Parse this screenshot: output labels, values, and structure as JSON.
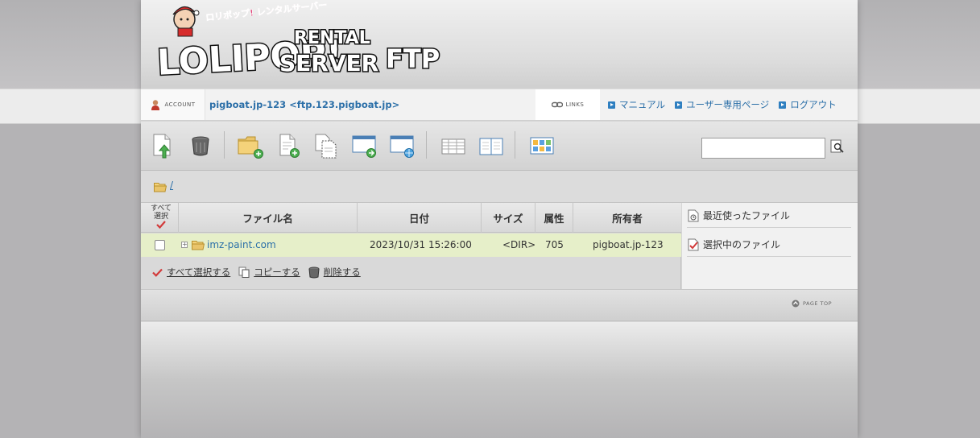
{
  "colors": {
    "link": "#2b6fa8",
    "row_highlight": "#e6efc9",
    "check": "#d23a3a"
  },
  "logo": {
    "line1": "LOLIPOP!",
    "line2": "RENTAL",
    "line3": "SERVER",
    "line4": "FTP",
    "tagline": "ロリポップ! レンタルサーバー"
  },
  "account": {
    "tag": "ACCOUNT",
    "name": "pigboat.jp-123 <ftp.123.pigboat.jp>"
  },
  "links": {
    "tag": "LINKS",
    "items": [
      "マニュアル",
      "ユーザー専用ページ",
      "ログアウト"
    ]
  },
  "toolbar": {
    "icons": [
      "upload-icon",
      "trash-icon",
      "new-folder-icon",
      "new-file-icon",
      "copy-icon",
      "window-add-icon",
      "window-globe-icon",
      "list-view-icon",
      "split-view-icon",
      "thumbnail-view-icon",
      "search-icon"
    ],
    "search_value": ""
  },
  "path": {
    "current": "/"
  },
  "table": {
    "select_all_line1": "すべて",
    "select_all_line2": "選択",
    "columns": [
      "ファイル名",
      "日付",
      "サイズ",
      "属性",
      "所有者"
    ],
    "rows": [
      {
        "name": "imz-paint.com",
        "date": "2023/10/31 15:26:00",
        "size": "<DIR>",
        "attr": "705",
        "owner": "pigboat.jp-123"
      }
    ]
  },
  "actions": [
    "すべて選択する",
    "コピーする",
    "削除する"
  ],
  "sidebar": {
    "recent": "最近使ったファイル",
    "selected": "選択中のファイル"
  },
  "footer": {
    "page_top": "PAGE TOP"
  }
}
